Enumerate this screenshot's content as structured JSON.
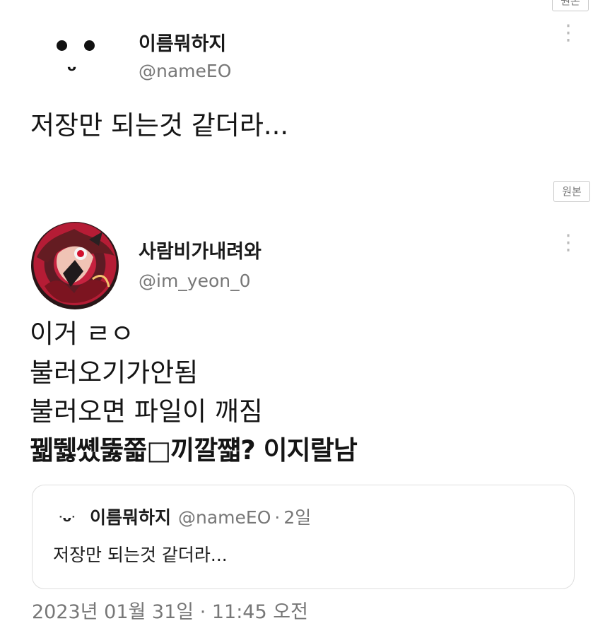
{
  "buttons": {
    "original_label": "원본"
  },
  "tweets": [
    {
      "display_name": "이름뭐하지",
      "handle": "@nameEO",
      "text": "저장만 되는것 같더라..."
    },
    {
      "display_name": "사람비가내려와",
      "handle": "@im_yeon_0",
      "lines": [
        "이거 ㄹㅇ",
        "불러오기가안됨",
        "불러오면 파일이 깨짐",
        "꿻뛣쏐뚫쫇□끼깔쨻? 이지랄남"
      ],
      "timestamp": "2023년 01월 31일 · 11:45 오전"
    }
  ],
  "quote": {
    "display_name": "이름뭐하지",
    "handle": "@nameEO",
    "separator": "·",
    "age": "2일",
    "text": "저장만 되는것 같더라..."
  },
  "icons": {
    "first_avatar": "smiley-avatar-icon",
    "second_avatar": "anime-avatar-icon",
    "more": "vertical-dots-icon",
    "quote_avatar": "small-smiley-avatar-icon"
  },
  "colors": {
    "text": "#151515",
    "muted": "#777777",
    "border": "#dedede",
    "more_icon": "#bbbbbb"
  }
}
